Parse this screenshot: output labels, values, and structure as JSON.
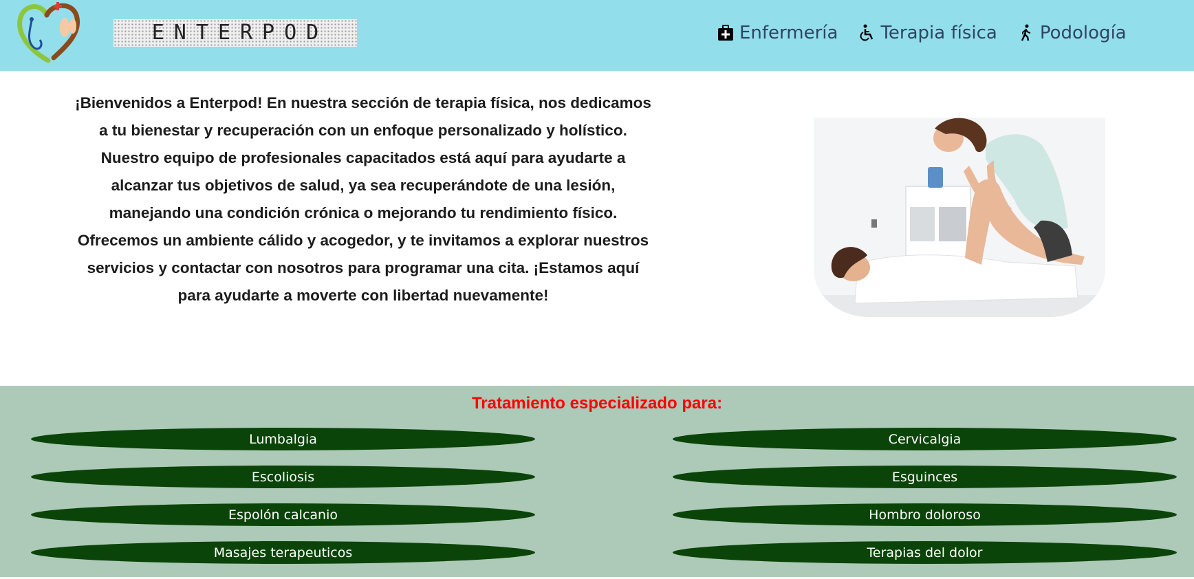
{
  "header": {
    "brand": "ENTERPOD",
    "nav": [
      {
        "label": "Enfermería",
        "icon": "medical-kit-icon"
      },
      {
        "label": "Terapia física",
        "icon": "wheelchair-icon"
      },
      {
        "label": "Podología",
        "icon": "walking-person-icon"
      }
    ]
  },
  "main": {
    "intro": "¡Bienvenidos a Enterpod! En nuestra sección de terapia física, nos dedicamos a tu bienestar y recuperación con un enfoque personalizado y holístico. Nuestro equipo de profesionales capacitados está aquí para ayudarte a alcanzar tus objetivos de salud, ya sea recuperándote de una lesión, manejando una condición crónica o mejorando tu rendimiento físico. Ofrecemos un ambiente cálido y acogedor, y te invitamos a explorar nuestros servicios y contactar con nosotros para programar una cita. ¡Estamos aquí para ayudarte a moverte con libertad nuevamente!"
  },
  "treatments": {
    "title": "Tratamiento especializado para:",
    "items": [
      "Lumbalgia",
      "Cervicalgia",
      "Escoliosis",
      "Esguinces",
      "Espolón calcanio",
      "Hombro doloroso",
      "Masajes terapeuticos",
      "Terapias del dolor"
    ]
  },
  "colors": {
    "header_bg": "#93deeb",
    "treatments_bg": "#adc9b7",
    "pill_bg": "#0b4409",
    "title_red": "#ff0000",
    "nav_text": "#2d4660"
  }
}
